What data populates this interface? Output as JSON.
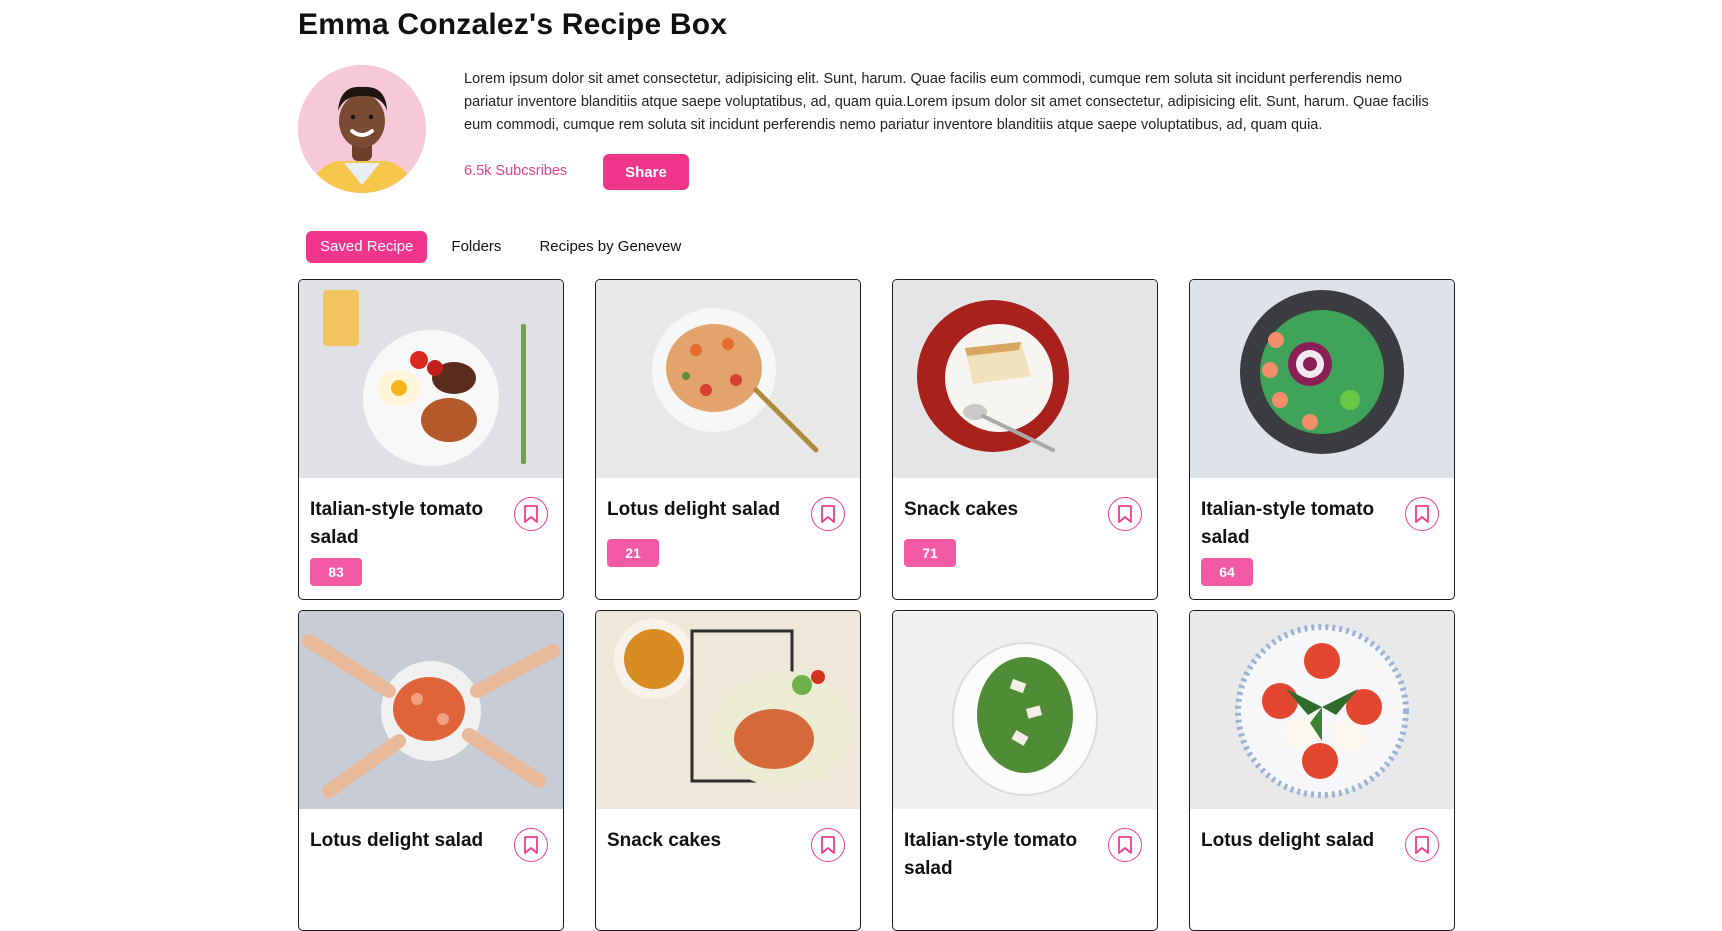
{
  "profile": {
    "title": "Emma Conzalez's Recipe Box",
    "bio": "Lorem ipsum dolor sit amet consectetur, adipisicing elit. Sunt, harum. Quae facilis eum commodi, cumque rem soluta sit incidunt perferendis nemo pariatur inventore blanditiis atque saepe voluptatibus, ad, quam quia.Lorem ipsum dolor sit amet consectetur, adipisicing elit. Sunt, harum. Quae facilis eum commodi, cumque rem soluta sit incidunt perferendis nemo pariatur inventore blanditiis atque saepe voluptatibus, ad, quam quia.",
    "subscribers": "6.5k Subcsribes",
    "share_label": "Share"
  },
  "tabs": [
    {
      "label": "Saved Recipe",
      "active": true
    },
    {
      "label": "Folders",
      "active": false
    },
    {
      "label": "Recipes by Genevew",
      "active": false
    }
  ],
  "colors": {
    "accent": "#f0358d",
    "badge": "#f35aa6"
  },
  "cards": [
    {
      "title": "Italian-style tomato salad",
      "count": "83"
    },
    {
      "title": "Lotus delight salad",
      "count": "21"
    },
    {
      "title": "Snack cakes",
      "count": "71"
    },
    {
      "title": "Italian-style tomato salad",
      "count": "64"
    },
    {
      "title": "Lotus delight salad",
      "count": ""
    },
    {
      "title": "Snack cakes",
      "count": ""
    },
    {
      "title": "Italian-style tomato salad",
      "count": ""
    },
    {
      "title": "Lotus delight salad",
      "count": ""
    }
  ],
  "icons": {
    "bookmark": "bookmark-icon"
  }
}
